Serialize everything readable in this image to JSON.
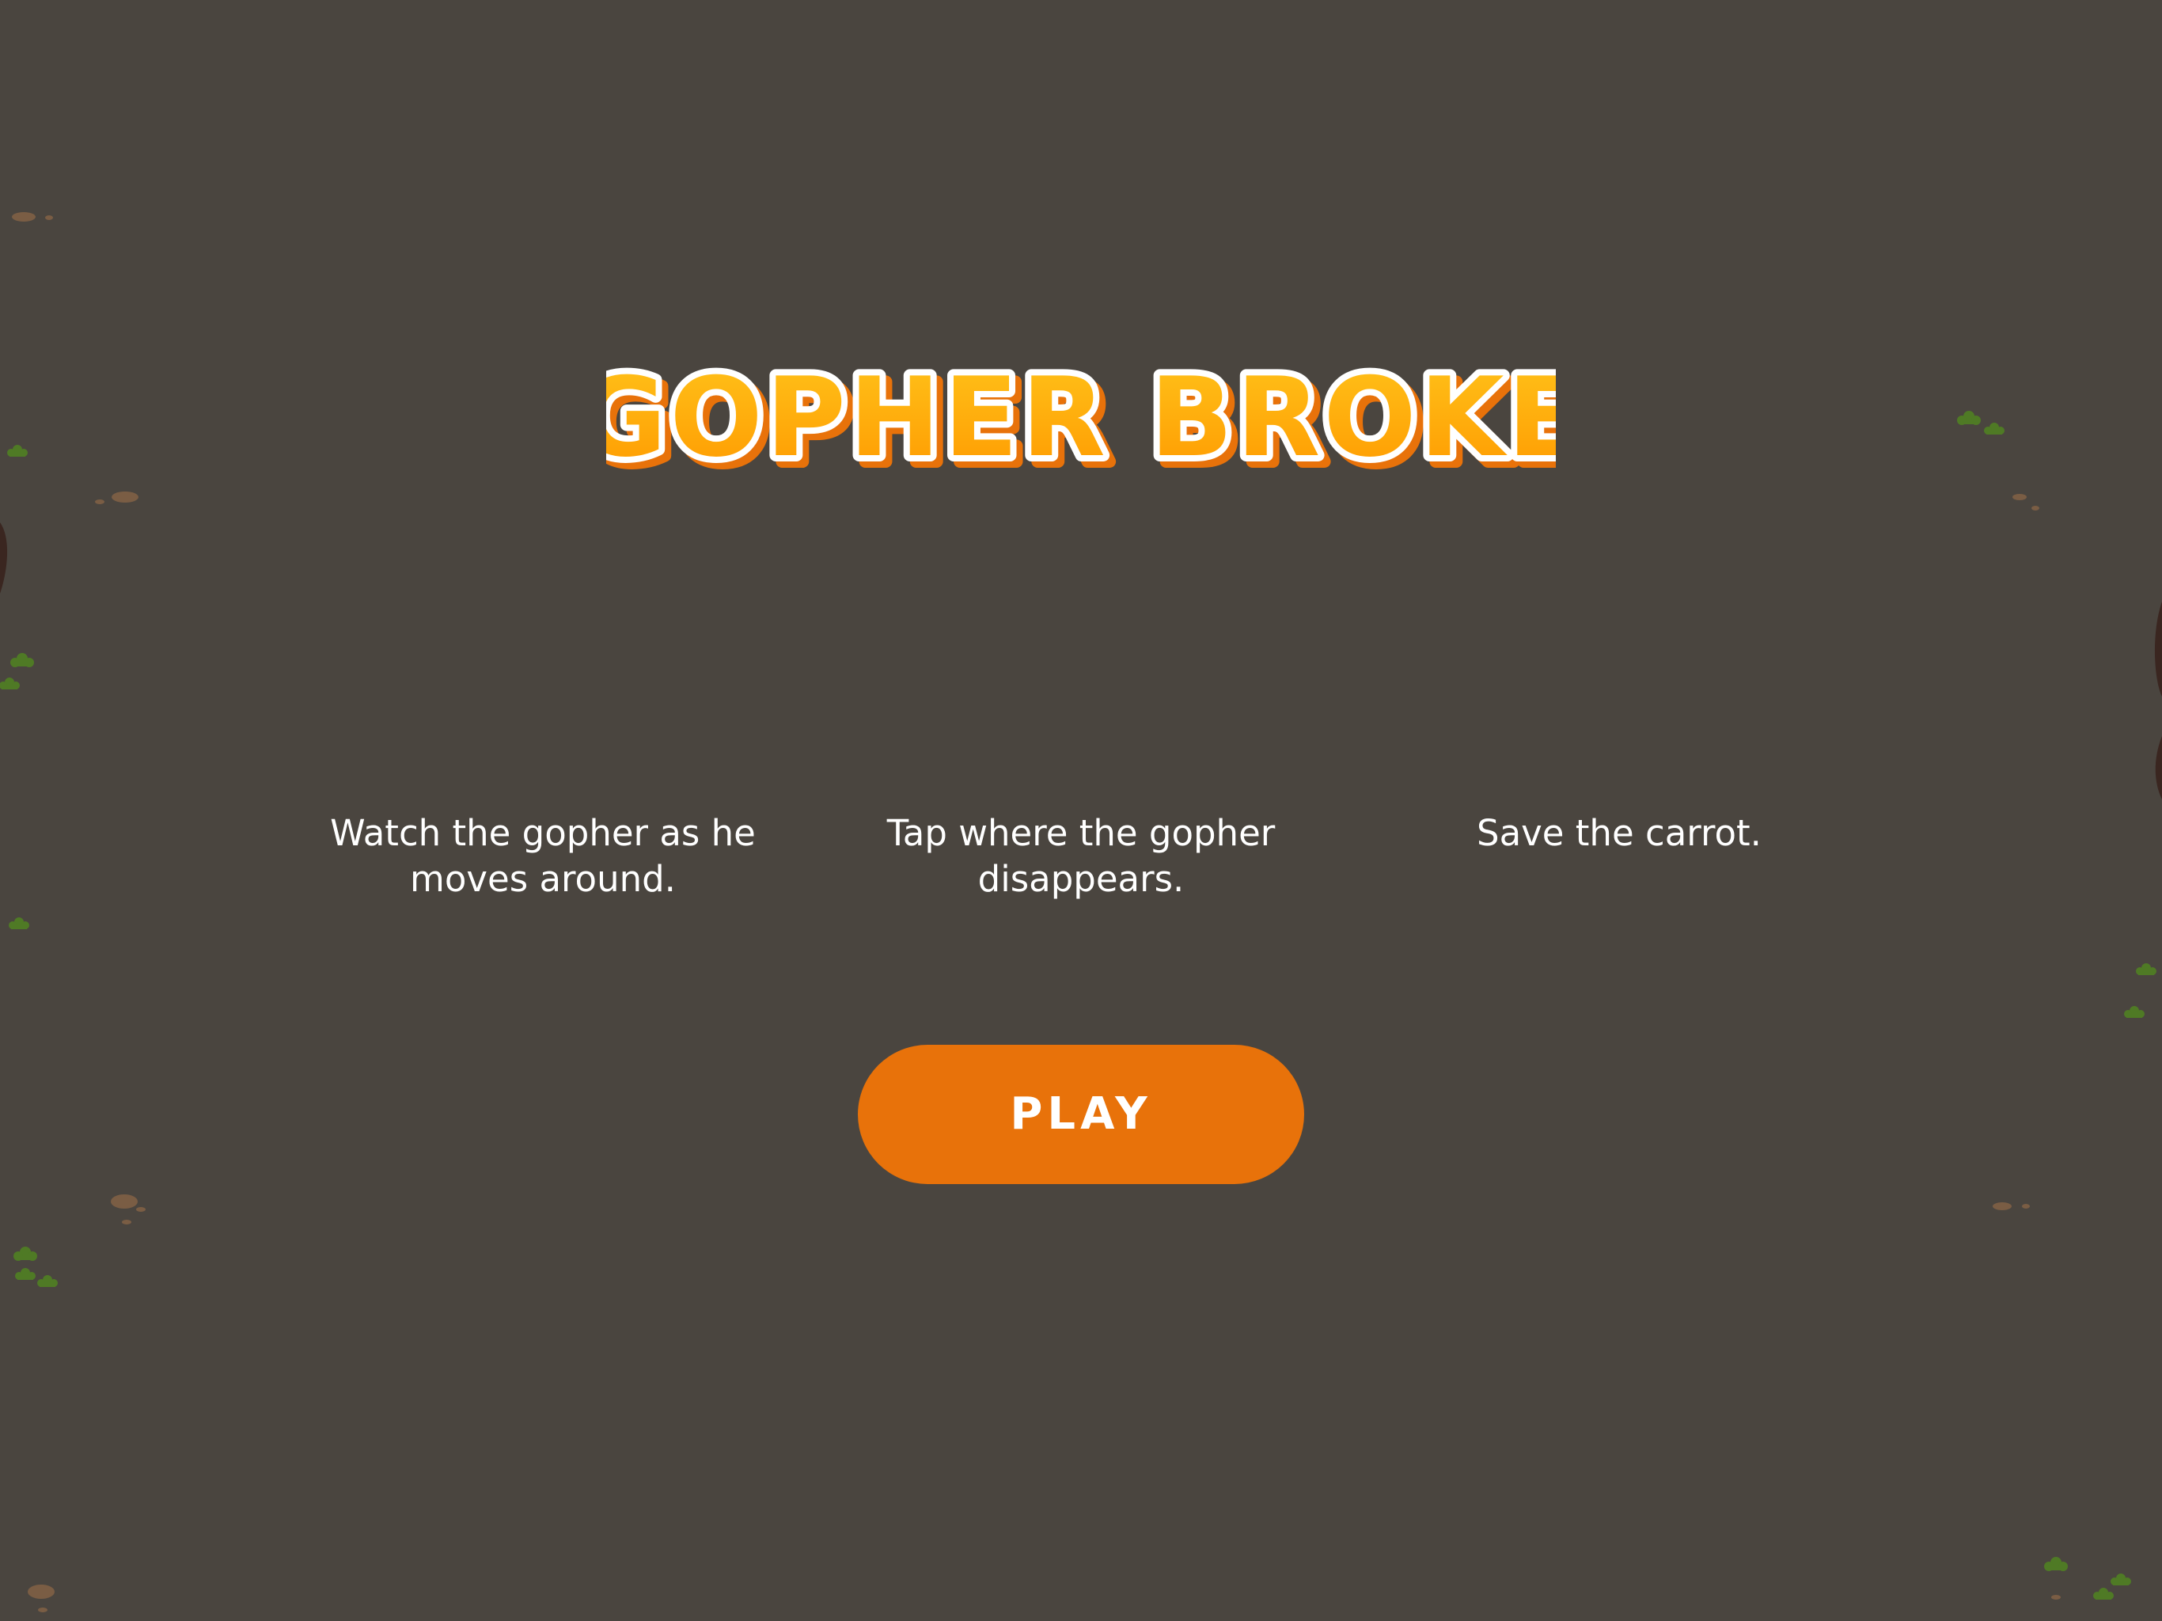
{
  "game": {
    "title": "GOPHER BROKE"
  },
  "instructions": [
    {
      "text": "Watch the gopher as he moves around."
    },
    {
      "text": "Tap where the gopher disappears."
    },
    {
      "text": "Save the carrot."
    }
  ],
  "play_button": {
    "label": "PLAY"
  },
  "colors": {
    "background": "#4a453f",
    "title_fill_top": "#ffc21a",
    "title_fill_bottom": "#ff9a00",
    "title_outline": "#ffffff",
    "title_shadow": "#e8720a",
    "button": "#e8720a",
    "text": "#ffffff",
    "grass": "#4f7a25",
    "pebble": "#7a5d44",
    "root": "#3a2620"
  }
}
